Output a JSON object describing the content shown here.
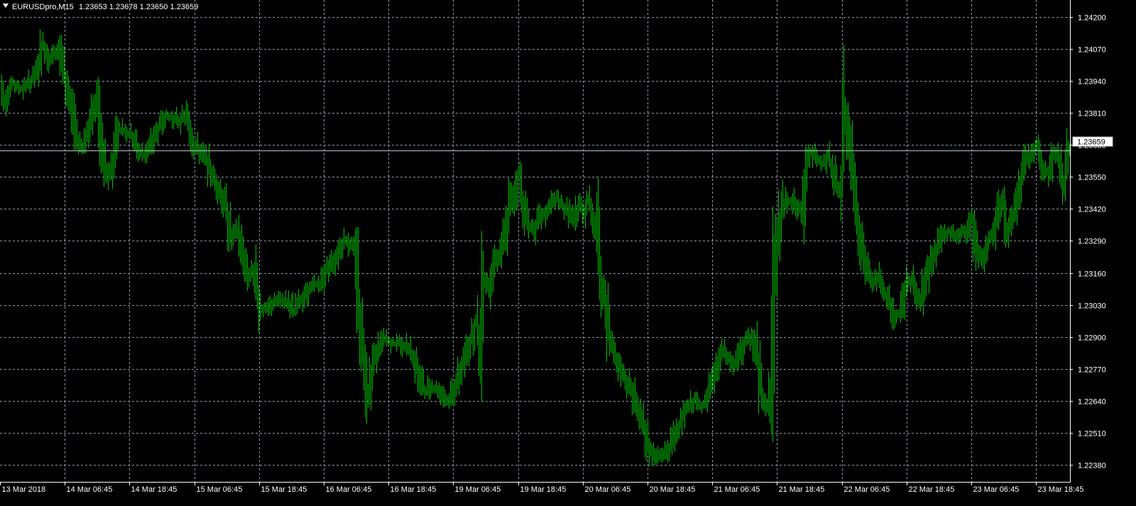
{
  "header": {
    "symbol_label": "EURUSDpro,M15",
    "ohlc": "1.23653 1.23678 1.23650 1.23659",
    "dropdown_icon": "triangle-down-icon"
  },
  "current_price": {
    "label": "1.23659",
    "value": 1.23659
  },
  "colors": {
    "background": "#000000",
    "grid": "#8a9aa8",
    "bars": "#00c000",
    "axis_text": "#ffffff",
    "price_line": "#b8c4cc"
  },
  "chart_data": {
    "type": "bar",
    "title": "EURUSDpro,M15",
    "ylim": [
      1.2231,
      1.2427
    ],
    "grid": true,
    "y_ticks": [
      "1.24200",
      "1.24070",
      "1.23940",
      "1.23810",
      "1.23680",
      "1.23550",
      "1.23420",
      "1.23290",
      "1.23160",
      "1.23030",
      "1.22900",
      "1.22770",
      "1.22640",
      "1.22510",
      "1.22380"
    ],
    "x_ticks": [
      "13 Mar 2018",
      "14 Mar 06:45",
      "14 Mar 18:45",
      "15 Mar 06:45",
      "15 Mar 18:45",
      "16 Mar 06:45",
      "16 Mar 18:45",
      "19 Mar 06:45",
      "19 Mar 18:45",
      "20 Mar 06:45",
      "20 Mar 18:45",
      "21 Mar 06:45",
      "21 Mar 18:45",
      "22 Mar 06:45",
      "22 Mar 18:45",
      "23 Mar 06:45",
      "23 Mar 18:45"
    ],
    "keypoints": [
      [
        0,
        1.2392
      ],
      [
        6,
        1.2386
      ],
      [
        16,
        1.2393
      ],
      [
        30,
        1.2391
      ],
      [
        44,
        1.2394
      ],
      [
        52,
        1.2398
      ],
      [
        60,
        1.2409
      ],
      [
        70,
        1.2403
      ],
      [
        82,
        1.2407
      ],
      [
        92,
        1.2394
      ],
      [
        100,
        1.2385
      ],
      [
        108,
        1.237
      ],
      [
        116,
        1.2368
      ],
      [
        124,
        1.2374
      ],
      [
        130,
        1.238
      ],
      [
        136,
        1.2386
      ],
      [
        142,
        1.2368
      ],
      [
        150,
        1.2355
      ],
      [
        158,
        1.236
      ],
      [
        166,
        1.2375
      ],
      [
        175,
        1.2374
      ],
      [
        185,
        1.2372
      ],
      [
        194,
        1.2366
      ],
      [
        202,
        1.2364
      ],
      [
        212,
        1.2368
      ],
      [
        222,
        1.2374
      ],
      [
        232,
        1.238
      ],
      [
        242,
        1.2379
      ],
      [
        252,
        1.2378
      ],
      [
        262,
        1.238
      ],
      [
        272,
        1.2369
      ],
      [
        282,
        1.2365
      ],
      [
        290,
        1.2362
      ],
      [
        300,
        1.2355
      ],
      [
        310,
        1.2349
      ],
      [
        318,
        1.2342
      ],
      [
        326,
        1.233
      ],
      [
        334,
        1.2333
      ],
      [
        342,
        1.2323
      ],
      [
        350,
        1.2315
      ],
      [
        358,
        1.2317
      ],
      [
        366,
        1.2302
      ],
      [
        376,
        1.2301
      ],
      [
        386,
        1.2304
      ],
      [
        396,
        1.2305
      ],
      [
        406,
        1.2304
      ],
      [
        414,
        1.23
      ],
      [
        422,
        1.2305
      ],
      [
        432,
        1.2308
      ],
      [
        442,
        1.2311
      ],
      [
        452,
        1.2312
      ],
      [
        460,
        1.2318
      ],
      [
        470,
        1.2321
      ],
      [
        478,
        1.2326
      ],
      [
        486,
        1.233
      ],
      [
        494,
        1.2327
      ],
      [
        500,
        1.2325
      ],
      [
        506,
        1.23
      ],
      [
        512,
        1.2285
      ],
      [
        518,
        1.2268
      ],
      [
        526,
        1.228
      ],
      [
        534,
        1.2286
      ],
      [
        542,
        1.2289
      ],
      [
        552,
        1.2287
      ],
      [
        562,
        1.2288
      ],
      [
        572,
        1.2286
      ],
      [
        582,
        1.2282
      ],
      [
        590,
        1.2274
      ],
      [
        598,
        1.2268
      ],
      [
        606,
        1.227
      ],
      [
        614,
        1.2269
      ],
      [
        622,
        1.2267
      ],
      [
        630,
        1.2264
      ],
      [
        638,
        1.2268
      ],
      [
        646,
        1.2274
      ],
      [
        654,
        1.2281
      ],
      [
        662,
        1.2288
      ],
      [
        670,
        1.2296
      ],
      [
        676,
        1.2285
      ],
      [
        680,
        1.2315
      ],
      [
        688,
        1.2311
      ],
      [
        696,
        1.2321
      ],
      [
        704,
        1.2324
      ],
      [
        712,
        1.2332
      ],
      [
        718,
        1.2344
      ],
      [
        724,
        1.2348
      ],
      [
        730,
        1.2356
      ],
      [
        736,
        1.2345
      ],
      [
        744,
        1.2336
      ],
      [
        752,
        1.2334
      ],
      [
        760,
        1.2338
      ],
      [
        768,
        1.234
      ],
      [
        776,
        1.2344
      ],
      [
        784,
        1.2346
      ],
      [
        792,
        1.2343
      ],
      [
        800,
        1.2341
      ],
      [
        808,
        1.2337
      ],
      [
        816,
        1.2344
      ],
      [
        822,
        1.2341
      ],
      [
        828,
        1.2346
      ],
      [
        834,
        1.234
      ],
      [
        840,
        1.2334
      ],
      [
        846,
        1.231
      ],
      [
        852,
        1.2305
      ],
      [
        858,
        1.229
      ],
      [
        866,
        1.2283
      ],
      [
        874,
        1.2277
      ],
      [
        882,
        1.2272
      ],
      [
        890,
        1.2268
      ],
      [
        898,
        1.226
      ],
      [
        906,
        1.2255
      ],
      [
        914,
        1.2245
      ],
      [
        922,
        1.2241
      ],
      [
        930,
        1.2242
      ],
      [
        938,
        1.2243
      ],
      [
        946,
        1.2247
      ],
      [
        954,
        1.2253
      ],
      [
        962,
        1.2258
      ],
      [
        970,
        1.2262
      ],
      [
        978,
        1.2264
      ],
      [
        986,
        1.2262
      ],
      [
        994,
        1.2263
      ],
      [
        1002,
        1.227
      ],
      [
        1010,
        1.2278
      ],
      [
        1018,
        1.2284
      ],
      [
        1026,
        1.2281
      ],
      [
        1034,
        1.2278
      ],
      [
        1042,
        1.2283
      ],
      [
        1050,
        1.2288
      ],
      [
        1058,
        1.229
      ],
      [
        1066,
        1.2282
      ],
      [
        1072,
        1.2268
      ],
      [
        1080,
        1.2262
      ],
      [
        1086,
        1.227
      ],
      [
        1090,
        1.2312
      ],
      [
        1096,
        1.2332
      ],
      [
        1102,
        1.2342
      ],
      [
        1108,
        1.2346
      ],
      [
        1116,
        1.2345
      ],
      [
        1124,
        1.2341
      ],
      [
        1130,
        1.2343
      ],
      [
        1136,
        1.2362
      ],
      [
        1142,
        1.2365
      ],
      [
        1150,
        1.2362
      ],
      [
        1158,
        1.236
      ],
      [
        1166,
        1.2363
      ],
      [
        1172,
        1.2359
      ],
      [
        1178,
        1.2352
      ],
      [
        1184,
        1.235
      ],
      [
        1190,
        1.2381
      ],
      [
        1196,
        1.2368
      ],
      [
        1202,
        1.2352
      ],
      [
        1208,
        1.2338
      ],
      [
        1214,
        1.2326
      ],
      [
        1220,
        1.2318
      ],
      [
        1228,
        1.2312
      ],
      [
        1236,
        1.2314
      ],
      [
        1244,
        1.2308
      ],
      [
        1252,
        1.2305
      ],
      [
        1260,
        1.2298
      ],
      [
        1268,
        1.23
      ],
      [
        1276,
        1.2311
      ],
      [
        1284,
        1.2313
      ],
      [
        1290,
        1.2307
      ],
      [
        1296,
        1.2304
      ],
      [
        1304,
        1.2314
      ],
      [
        1312,
        1.2322
      ],
      [
        1320,
        1.2326
      ],
      [
        1328,
        1.2331
      ],
      [
        1336,
        1.2333
      ],
      [
        1344,
        1.2331
      ],
      [
        1352,
        1.2332
      ],
      [
        1360,
        1.2333
      ],
      [
        1368,
        1.2338
      ],
      [
        1376,
        1.2325
      ],
      [
        1384,
        1.2322
      ],
      [
        1392,
        1.2329
      ],
      [
        1400,
        1.2332
      ],
      [
        1406,
        1.2341
      ],
      [
        1412,
        1.2346
      ],
      [
        1418,
        1.2334
      ],
      [
        1424,
        1.2338
      ],
      [
        1430,
        1.2342
      ],
      [
        1436,
        1.2352
      ],
      [
        1444,
        1.2361
      ],
      [
        1452,
        1.2364
      ],
      [
        1460,
        1.2367
      ],
      [
        1468,
        1.2358
      ],
      [
        1476,
        1.2356
      ],
      [
        1484,
        1.2364
      ],
      [
        1490,
        1.2363
      ],
      [
        1498,
        1.2353
      ],
      [
        1503,
        1.2364
      ],
      [
        1507,
        1.23659
      ]
    ]
  }
}
